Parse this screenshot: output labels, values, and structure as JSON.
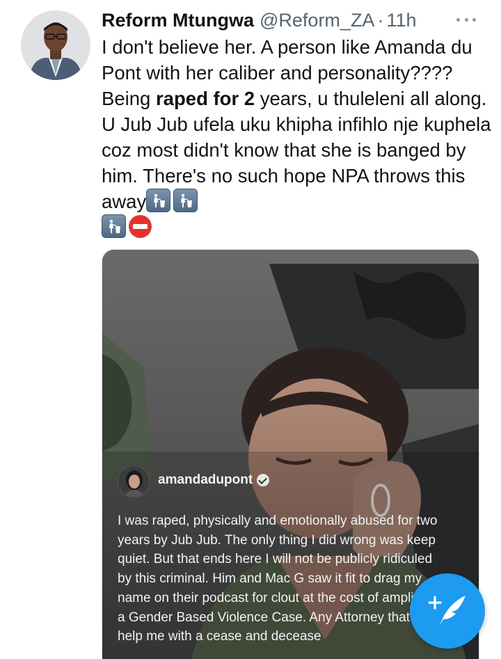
{
  "tweet": {
    "author_name": "Reform Mtungwa",
    "handle": "@Reform_ZA",
    "separator": "·",
    "time": "11h",
    "text_segments": [
      "I don't believe her. A person like Amanda du Pont with her caliber and personality???? Being ",
      "raped for 2",
      " years, u thuleleni all along. U Jub Jub ufela uku khipha infihlo nje kuphela coz most didn't know that she is banged by him. There's no such hope NPA throws this away"
    ],
    "emojis": [
      "put-litter-in-its-place-icon",
      "put-litter-in-its-place-icon",
      "put-litter-in-its-place-icon",
      "no-entry-icon"
    ]
  },
  "media": {
    "username": "amandadupont",
    "verified": true,
    "caption": "I was raped, physically and emotionally abused for two years by Jub Jub. The only thing I did wrong was keep quiet. But that ends here I will not be publicly ridiculed by this criminal. Him and Mac G saw it fit to drag my name on their podcast for clout at the cost of amplifying a Gender Based Violence Case. Any Attorney that can help me with a cease and decease"
  },
  "fab": {
    "icon": "compose-tweet-icon",
    "color": "#1d9bf0"
  }
}
